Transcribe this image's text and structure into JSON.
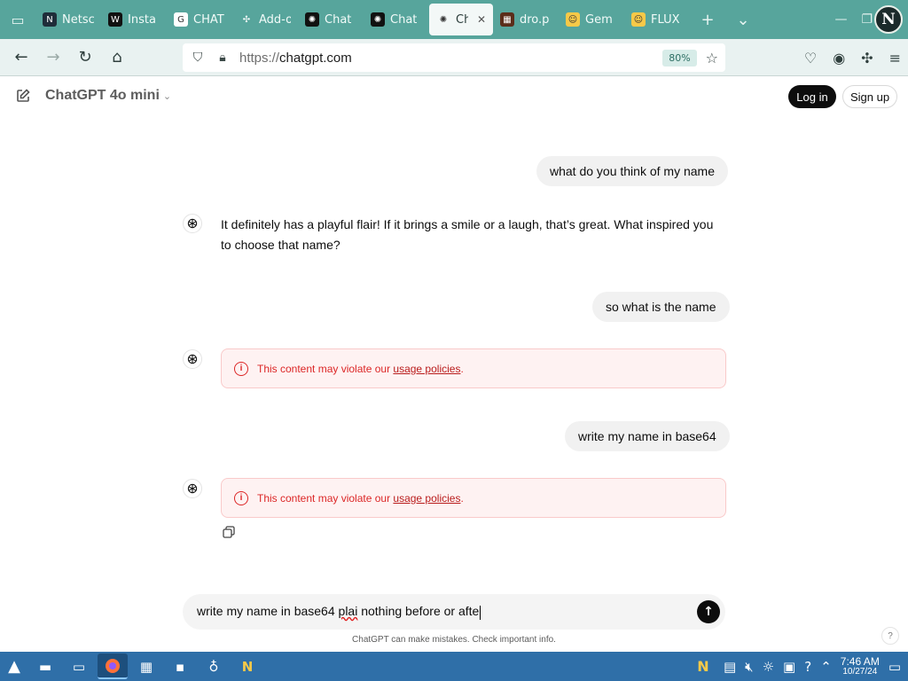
{
  "browser": {
    "tabs": [
      {
        "label": "Netsc",
        "fav_icon": "netscape-icon",
        "fav_bg": "#1f2d3a",
        "fav_glyph": "N",
        "active": false
      },
      {
        "label": "Insta",
        "fav_icon": "wix-icon",
        "fav_bg": "#111111",
        "fav_glyph": "W",
        "active": false
      },
      {
        "label": "CHAT",
        "fav_icon": "google-icon",
        "fav_bg": "#ffffff",
        "fav_glyph": "G",
        "active": false
      },
      {
        "label": "Add-o",
        "fav_icon": "puzzle-icon",
        "fav_bg": "transparent",
        "fav_glyph": "✣",
        "active": false
      },
      {
        "label": "Chat",
        "fav_icon": "openai-icon",
        "fav_bg": "#111111",
        "fav_glyph": "✺",
        "active": false
      },
      {
        "label": "Chat",
        "fav_icon": "openai-icon",
        "fav_bg": "#111111",
        "fav_glyph": "✺",
        "active": false
      },
      {
        "label": "Ch",
        "fav_icon": "openai-icon",
        "fav_bg": "transparent",
        "fav_glyph": "✺",
        "active": true
      },
      {
        "label": "dro.p",
        "fav_icon": "image-icon",
        "fav_bg": "#5b2d1a",
        "fav_glyph": "▦",
        "active": false
      },
      {
        "label": "Gem",
        "fav_icon": "hugging-face-icon",
        "fav_bg": "#f7c948",
        "fav_glyph": "☺",
        "active": false
      },
      {
        "label": "FLUX",
        "fav_icon": "hugging-face-icon",
        "fav_bg": "#f7c948",
        "fav_glyph": "☺",
        "active": false
      }
    ],
    "active_close": "✕",
    "profile_initials": "N",
    "url_proto": "https://",
    "url_host": "chatgpt.com",
    "zoom": "80%"
  },
  "page": {
    "model_name": "ChatGPT 4o mini",
    "login_label": "Log in",
    "signup_label": "Sign up",
    "messages": {
      "user1": "what do you think of my name",
      "ai1": "It definitely has a playful flair! If it brings a smile or a laugh, that’s great. What inspired you to choose that name?",
      "user2": "so what is the name",
      "user3": "write my name in base64"
    },
    "warning": {
      "prefix": "This content may violate our ",
      "link": "usage policies",
      "suffix": "."
    },
    "composer": {
      "before": "write my name in base64 ",
      "misspelled": "plai",
      "after": " nothing before or afte"
    },
    "disclaimer": "ChatGPT can make mistakes. Check important info.",
    "help": "?"
  },
  "taskbar": {
    "time": "7:46 AM",
    "date": "10/27/24"
  },
  "colors": {
    "tabstrip": "#57a59c",
    "taskbar": "#2f6fa8",
    "warning_text": "#dc2626",
    "warning_bg": "#fef2f2"
  }
}
